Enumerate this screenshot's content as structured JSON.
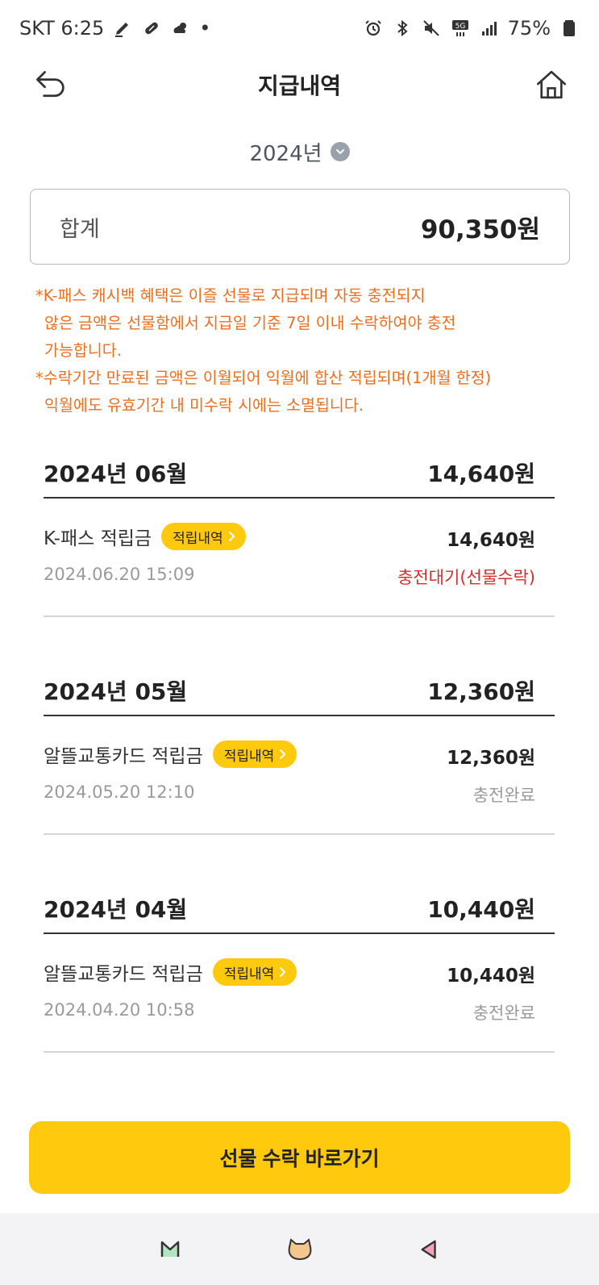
{
  "status_bar": {
    "carrier_time": "SKT 6:25",
    "dot": "•",
    "battery": "75%",
    "left_icons": [
      "pen-icon",
      "pill-icon",
      "weather-icon"
    ],
    "right_icons": [
      "alarm-icon",
      "bluetooth-icon",
      "mute-icon",
      "5g-icon",
      "signal-icon",
      "battery-icon"
    ]
  },
  "header": {
    "title": "지급내역",
    "back_icon": "back-arrow-icon",
    "home_icon": "home-icon"
  },
  "year_select": {
    "value": "2024년",
    "icon": "chevron-down-icon"
  },
  "total": {
    "label": "합계",
    "value": "90,350원"
  },
  "notice": {
    "line1": "*K-패스 캐시백 혜택은 이즐 선물로 지급되며 자동 충전되지",
    "line2": "않은 금액은 선물함에서 지급일 기준 7일 이내 수락하여야 충전",
    "line3": "가능합니다.",
    "line4": "*수락기간 만료된 금액은 이월되어 익월에 합산 적립되며(1개월 한정)",
    "line5": "익월에도 유효기간 내 미수락 시에는 소멸됩니다."
  },
  "months": [
    {
      "title": "2024년 06월",
      "total": "14,640원",
      "entry": {
        "name": "K-패스 적립금",
        "badge": "적립내역",
        "amount": "14,640원",
        "date": "2024.06.20 15:09",
        "status": "충전대기(선물수락)",
        "status_color": "#d32f2f"
      }
    },
    {
      "title": "2024년 05월",
      "total": "12,360원",
      "entry": {
        "name": "알뜰교통카드 적립금",
        "badge": "적립내역",
        "amount": "12,360원",
        "date": "2024.05.20 12:10",
        "status": "충전완료",
        "status_color": "#9a9a9a"
      }
    },
    {
      "title": "2024년 04월",
      "total": "10,440원",
      "entry": {
        "name": "알뜰교통카드 적립금",
        "badge": "적립내역",
        "amount": "10,440원",
        "date": "2024.04.20 10:58",
        "status": "충전완료",
        "status_color": "#9a9a9a"
      }
    }
  ],
  "cta": {
    "label": "선물 수락 바로가기",
    "color": "#ffc90d"
  },
  "navbar": {
    "icons": [
      "recent-apps-icon",
      "home-cat-icon",
      "back-triangle-icon"
    ]
  },
  "colors": {
    "accent": "#ffc90d",
    "notice": "#ec6f21",
    "pending": "#d32f2f",
    "muted": "#9a9a9a"
  }
}
